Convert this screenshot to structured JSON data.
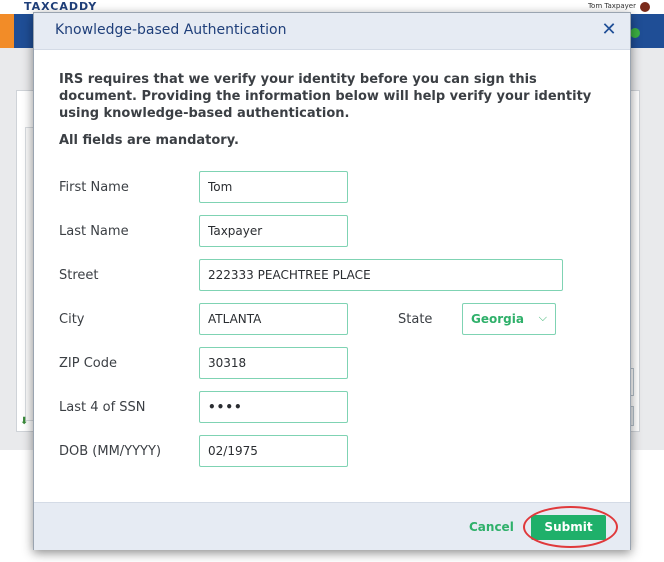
{
  "background": {
    "logo": "TAXCADDY",
    "user": "Tom Taxpayer"
  },
  "modal": {
    "title": "Knowledge-based Authentication",
    "close_symbol": "✕",
    "intro": "IRS requires that we verify your identity before you can sign this document. Providing the information below will help verify your identity using knowledge-based authentication.",
    "mandatory_note": "All fields are mandatory.",
    "fields": {
      "first_name": {
        "label": "First Name",
        "value": "Tom"
      },
      "last_name": {
        "label": "Last Name",
        "value": "Taxpayer"
      },
      "street": {
        "label": "Street",
        "value": "222333 PEACHTREE PLACE"
      },
      "city": {
        "label": "City",
        "value": "ATLANTA"
      },
      "state": {
        "label": "State",
        "value": "Georgia"
      },
      "zip": {
        "label": "ZIP Code",
        "value": "30318"
      },
      "ssn4": {
        "label": "Last 4 of SSN",
        "value": "••••"
      },
      "dob": {
        "label": "DOB (MM/YYYY)",
        "value": "02/1975"
      }
    },
    "cancel_label": "Cancel",
    "submit_label": "Submit"
  },
  "colors": {
    "accent_green": "#1fb06a",
    "header_blue": "#1f3f7a",
    "highlight_red": "#e0393b"
  }
}
